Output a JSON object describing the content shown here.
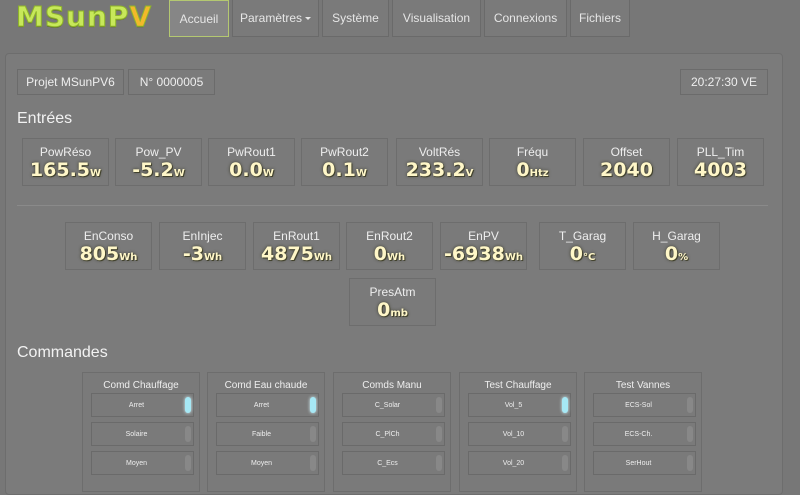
{
  "app": {
    "logo_main": "MSunP",
    "logo_dot": "V"
  },
  "nav": [
    {
      "label": "Accueil",
      "active": true
    },
    {
      "label": "Paramètres",
      "dropdown": true
    },
    {
      "label": "Système"
    },
    {
      "label": "Visualisation"
    },
    {
      "label": "Connexions"
    },
    {
      "label": "Fichiers"
    }
  ],
  "header": {
    "project": "Projet MSunPV6",
    "serial": "N° 0000005",
    "clock": "20:27:30 VE"
  },
  "sections": {
    "inputs": "Entrées",
    "commands": "Commandes"
  },
  "inputs_row1": [
    {
      "label": "PowRéso",
      "value": "165.5",
      "unit": "W"
    },
    {
      "label": "Pow_PV",
      "value": "-5.2",
      "unit": "W"
    },
    {
      "label": "PwRout1",
      "value": "0.0",
      "unit": "W"
    },
    {
      "label": "PwRout2",
      "value": "0.1",
      "unit": "W"
    },
    {
      "label": "VoltRés",
      "value": "233.2",
      "unit": "V"
    },
    {
      "label": "Fréqu",
      "value": "0",
      "unit": "Htz"
    },
    {
      "label": "Offset",
      "value": "2040",
      "unit": ""
    },
    {
      "label": "PLL_Tim",
      "value": "4003",
      "unit": ""
    }
  ],
  "inputs_row2": [
    {
      "label": "EnConso",
      "value": "805",
      "unit": "Wh"
    },
    {
      "label": "EnInjec",
      "value": "-3",
      "unit": "Wh"
    },
    {
      "label": "EnRout1",
      "value": "4875",
      "unit": "Wh"
    },
    {
      "label": "EnRout2",
      "value": "0",
      "unit": "Wh"
    },
    {
      "label": "EnPV",
      "value": "-6938",
      "unit": "Wh"
    },
    {
      "label": "T_Garag",
      "value": "0",
      "unit": "°C"
    },
    {
      "label": "H_Garag",
      "value": "0",
      "unit": "%"
    }
  ],
  "inputs_row3": [
    {
      "label": "PresAtm",
      "value": "0",
      "unit": "mb"
    }
  ],
  "commands": [
    {
      "title": "Comd Chauffage",
      "options": [
        {
          "label": "Arret",
          "on": true
        },
        {
          "label": "Solaire",
          "on": false
        },
        {
          "label": "Moyen",
          "on": false
        }
      ]
    },
    {
      "title": "Comd Eau chaude",
      "options": [
        {
          "label": "Arret",
          "on": true
        },
        {
          "label": "Faible",
          "on": false
        },
        {
          "label": "Moyen",
          "on": false
        }
      ]
    },
    {
      "title": "Comds Manu",
      "options": [
        {
          "label": "C_Solar",
          "on": false
        },
        {
          "label": "C_PlCh",
          "on": false
        },
        {
          "label": "C_Ecs",
          "on": false
        }
      ]
    },
    {
      "title": "Test Chauffage",
      "options": [
        {
          "label": "Vol_5",
          "on": true
        },
        {
          "label": "Vol_10",
          "on": false
        },
        {
          "label": "Vol_20",
          "on": false
        }
      ]
    },
    {
      "title": "Test Vannes",
      "options": [
        {
          "label": "ECS-Sol",
          "on": false
        },
        {
          "label": "ECS-Ch.",
          "on": false
        },
        {
          "label": "SerHout",
          "on": false
        }
      ]
    }
  ]
}
